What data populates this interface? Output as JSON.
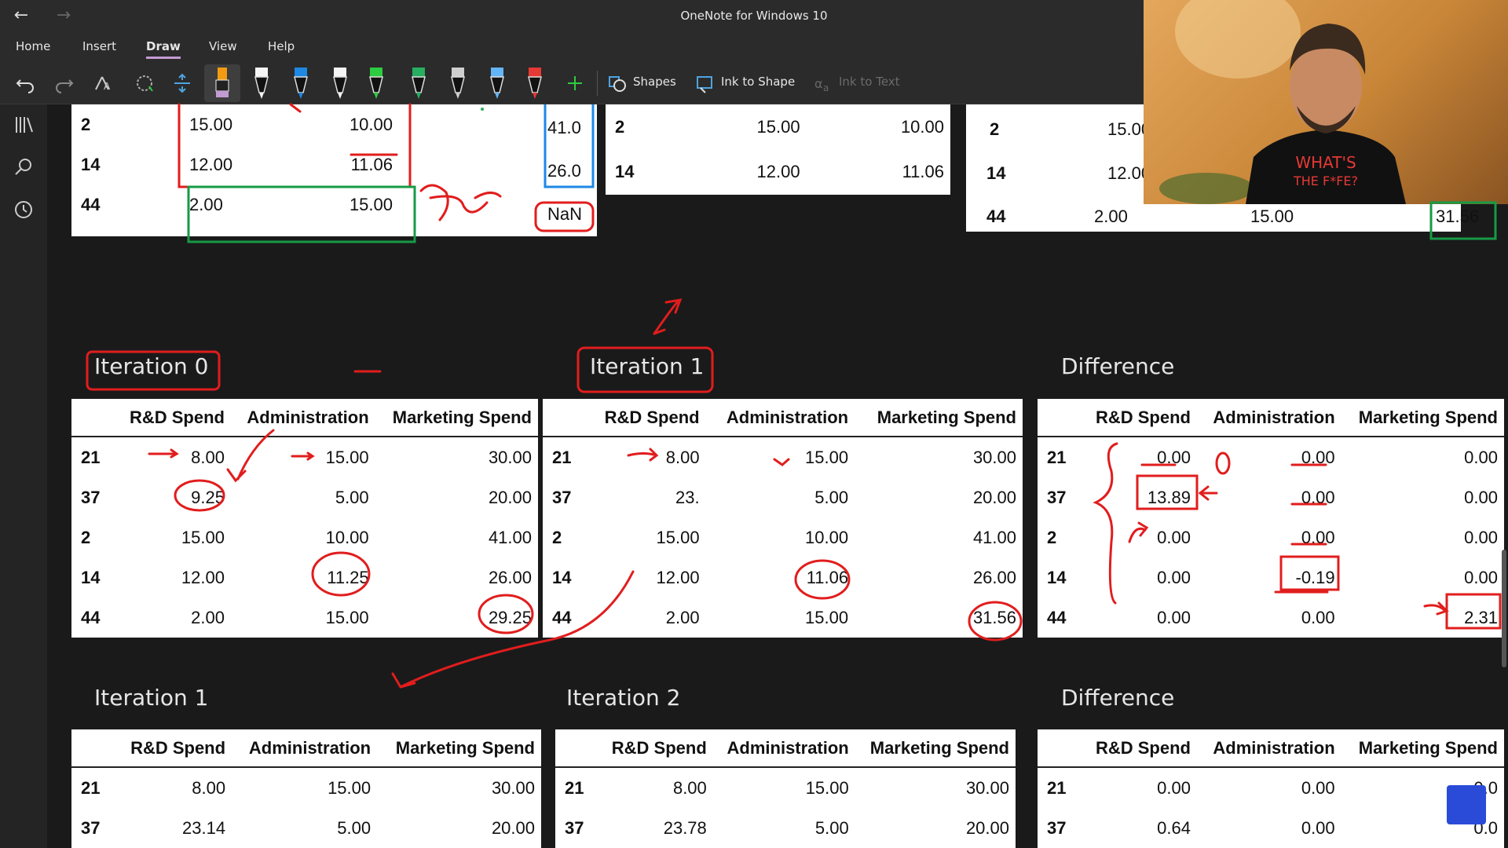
{
  "window": {
    "title": "OneNote for Windows 10"
  },
  "menu": [
    "Home",
    "Insert",
    "Draw",
    "View",
    "Help"
  ],
  "menu_active": "Draw",
  "toolbar": {
    "shapes_label": "Shapes",
    "ink_to_shape_label": "Ink to Shape",
    "ink_to_text_label": "Ink to Text",
    "pen_colors": [
      "#f5f5f5",
      "#1e88e5",
      "#f5f5f5",
      "#2ecc40",
      "#27ae60",
      "#cfcfcf",
      "#64b5f6",
      "#e53935"
    ]
  },
  "top_fragments": {
    "left": {
      "rows": [
        {
          "idx": "2",
          "a": "15.00",
          "b": "10.00",
          "c": "41.0"
        },
        {
          "idx": "14",
          "a": "12.00",
          "b": "11.06",
          "c": "26.0"
        },
        {
          "idx": "44",
          "a": "2.00",
          "b": "15.00",
          "c": "NaN"
        }
      ]
    },
    "mid": {
      "rows": [
        {
          "idx": "2",
          "a": "15.00",
          "b": "10.00"
        },
        {
          "idx": "14",
          "a": "12.00",
          "b": "11.06"
        }
      ]
    },
    "right": {
      "rows": [
        {
          "idx": "2",
          "a": "15.00"
        },
        {
          "idx": "14",
          "a": "12.00"
        },
        {
          "idx": "44",
          "a": "2.00",
          "b": "15.00",
          "c": "31.56"
        }
      ]
    }
  },
  "headers": [
    "",
    "R&D Spend",
    "Administration",
    "Marketing Spend"
  ],
  "blocks": [
    {
      "label": "Iteration 0",
      "rows": [
        [
          "21",
          "8.00",
          "15.00",
          "30.00"
        ],
        [
          "37",
          "9.25",
          "5.00",
          "20.00"
        ],
        [
          "2",
          "15.00",
          "10.00",
          "41.00"
        ],
        [
          "14",
          "12.00",
          "11.25",
          "26.00"
        ],
        [
          "44",
          "2.00",
          "15.00",
          "29.25"
        ]
      ]
    },
    {
      "label": "Iteration 1",
      "rows": [
        [
          "21",
          "8.00",
          "15.00",
          "30.00"
        ],
        [
          "37",
          "23.",
          "5.00",
          "20.00"
        ],
        [
          "2",
          "15.00",
          "10.00",
          "41.00"
        ],
        [
          "14",
          "12.00",
          "11.06",
          "26.00"
        ],
        [
          "44",
          "2.00",
          "15.00",
          "31.56"
        ]
      ]
    },
    {
      "label": "Difference",
      "rows": [
        [
          "21",
          "0.00",
          "0.00",
          "0.00"
        ],
        [
          "37",
          "13.89",
          "0.00",
          "0.00"
        ],
        [
          "2",
          "0.00",
          "0.00",
          "0.00"
        ],
        [
          "14",
          "0.00",
          "-0.19",
          "0.00"
        ],
        [
          "44",
          "0.00",
          "0.00",
          "2.31"
        ]
      ]
    },
    {
      "label": "Iteration 1",
      "rows": [
        [
          "21",
          "8.00",
          "15.00",
          "30.00"
        ],
        [
          "37",
          "23.14",
          "5.00",
          "20.00"
        ]
      ]
    },
    {
      "label": "Iteration 2",
      "rows": [
        [
          "21",
          "8.00",
          "15.00",
          "30.00"
        ],
        [
          "37",
          "23.78",
          "5.00",
          "20.00"
        ]
      ]
    },
    {
      "label": "Difference",
      "rows": [
        [
          "21",
          "0.00",
          "0.00",
          "0.0"
        ],
        [
          "37",
          "0.64",
          "0.00",
          "0.0"
        ]
      ]
    }
  ],
  "ink_annotations": {
    "top_left_note": "Y_tu",
    "difference_note": "0"
  },
  "webcam": {
    "shirt_text": "WHAT'S THE F*FE?"
  }
}
